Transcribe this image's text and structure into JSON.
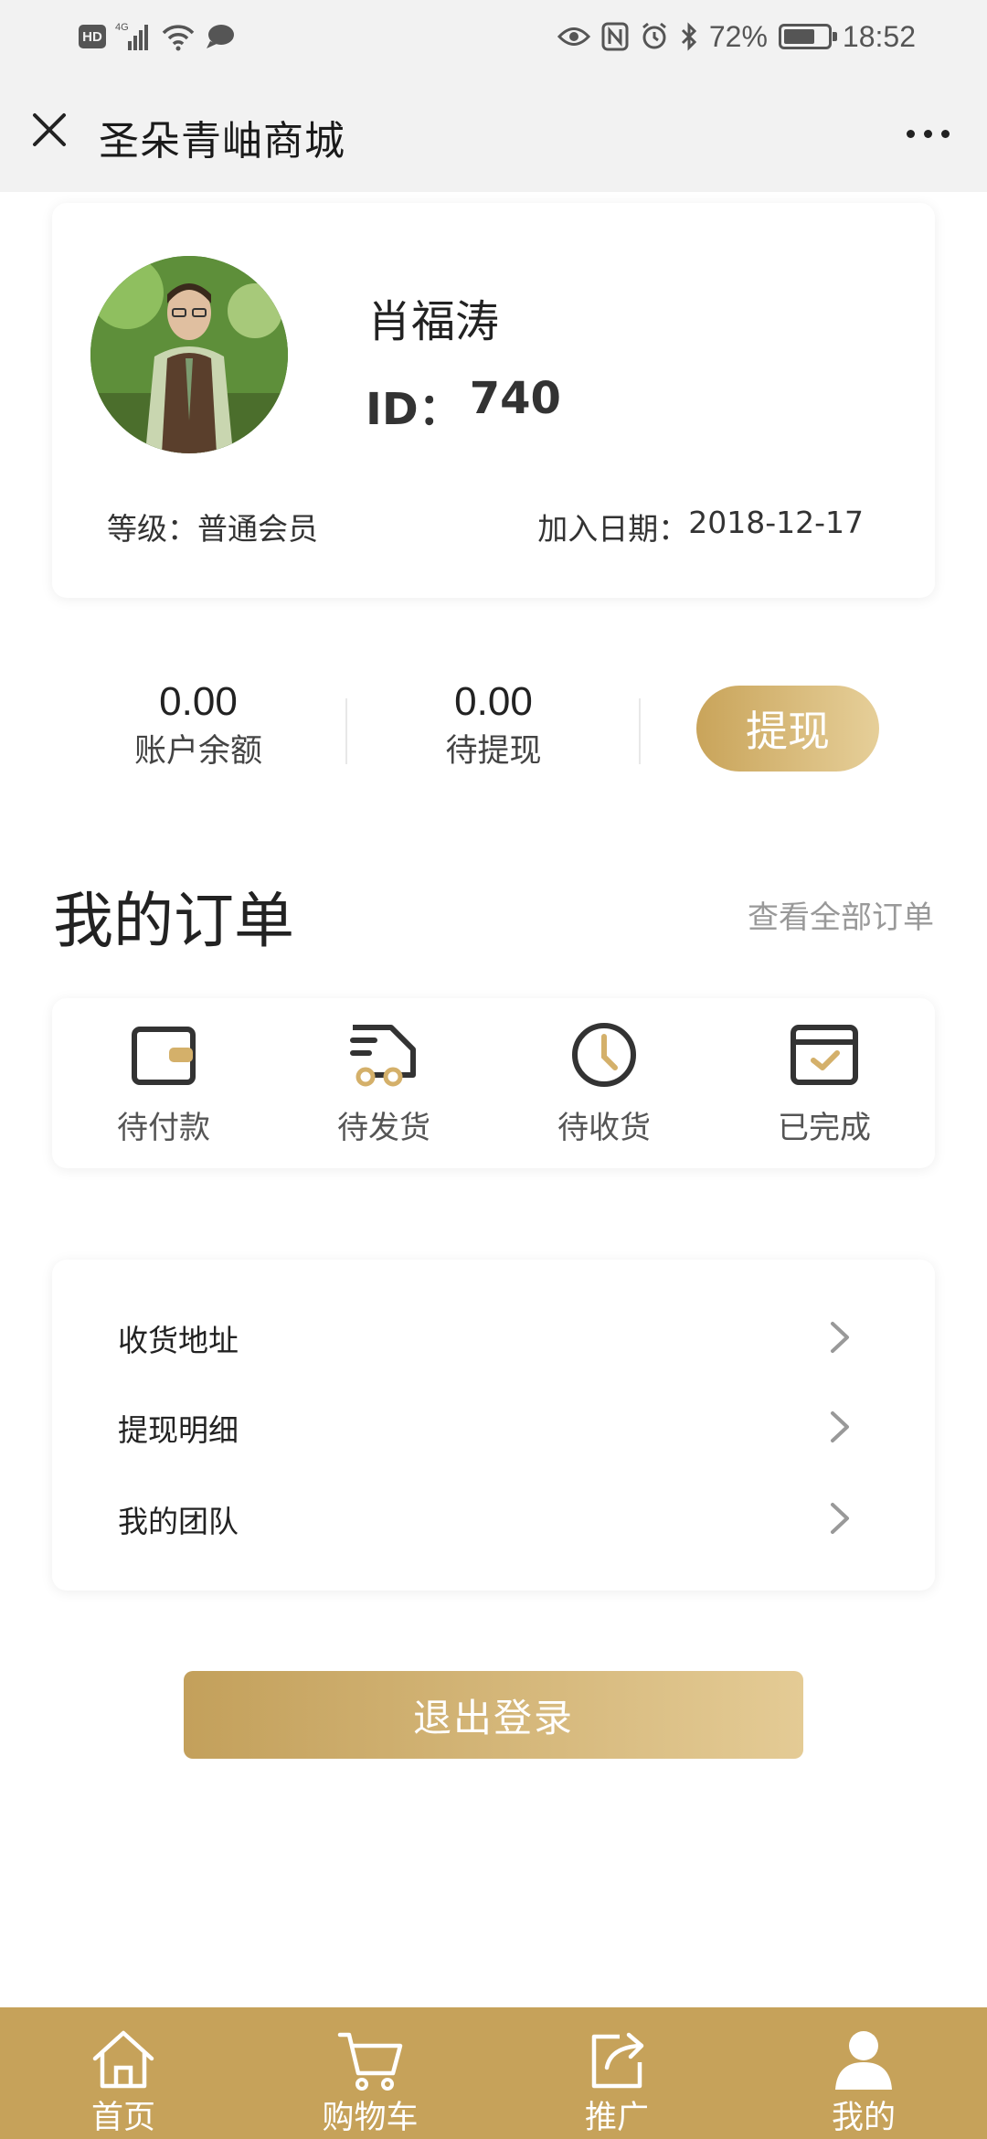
{
  "status_bar": {
    "hd_badge": "HD",
    "network": "4G",
    "battery": "72%",
    "battery_level": 0.72,
    "time": "18:52",
    "icons": [
      "signal-icon",
      "wifi-icon",
      "chat-bubble-icon",
      "eye-icon",
      "nfc-icon",
      "alarm-icon",
      "bluetooth-icon",
      "battery-icon"
    ]
  },
  "header": {
    "title": "圣朵青岫商城",
    "close_icon": "close-icon",
    "more_icon": "more-dots-icon"
  },
  "profile": {
    "name": "肖福涛",
    "id_label": "ID：",
    "id_value": "740",
    "level_label": "等级：",
    "level_value": "普通会员",
    "join_label": "加入日期：",
    "join_value": "2018-12-17"
  },
  "balance": {
    "account_value": "0.00",
    "account_label": "账户余额",
    "pending_value": "0.00",
    "pending_label": "待提现",
    "withdraw_button": "提现"
  },
  "orders": {
    "title": "我的订单",
    "view_all": "查看全部订单",
    "items": [
      {
        "label": "待付款",
        "icon": "wallet-icon"
      },
      {
        "label": "待发货",
        "icon": "delivery-truck-icon"
      },
      {
        "label": "待收货",
        "icon": "clock-icon"
      },
      {
        "label": "已完成",
        "icon": "completed-box-icon"
      }
    ]
  },
  "menu": {
    "items": [
      {
        "label": "收货地址"
      },
      {
        "label": "提现明细"
      },
      {
        "label": "我的团队"
      }
    ]
  },
  "logout_button": "退出登录",
  "bottom_nav": {
    "items": [
      {
        "label": "首页",
        "icon": "home-icon"
      },
      {
        "label": "购物车",
        "icon": "cart-icon"
      },
      {
        "label": "推广",
        "icon": "share-icon"
      },
      {
        "label": "我的",
        "icon": "user-icon"
      }
    ]
  },
  "colors": {
    "gold": "#c6a25a",
    "gold_light": "#e6cf99",
    "background": "#ffffff",
    "titlebar": "#f2f2f2"
  }
}
